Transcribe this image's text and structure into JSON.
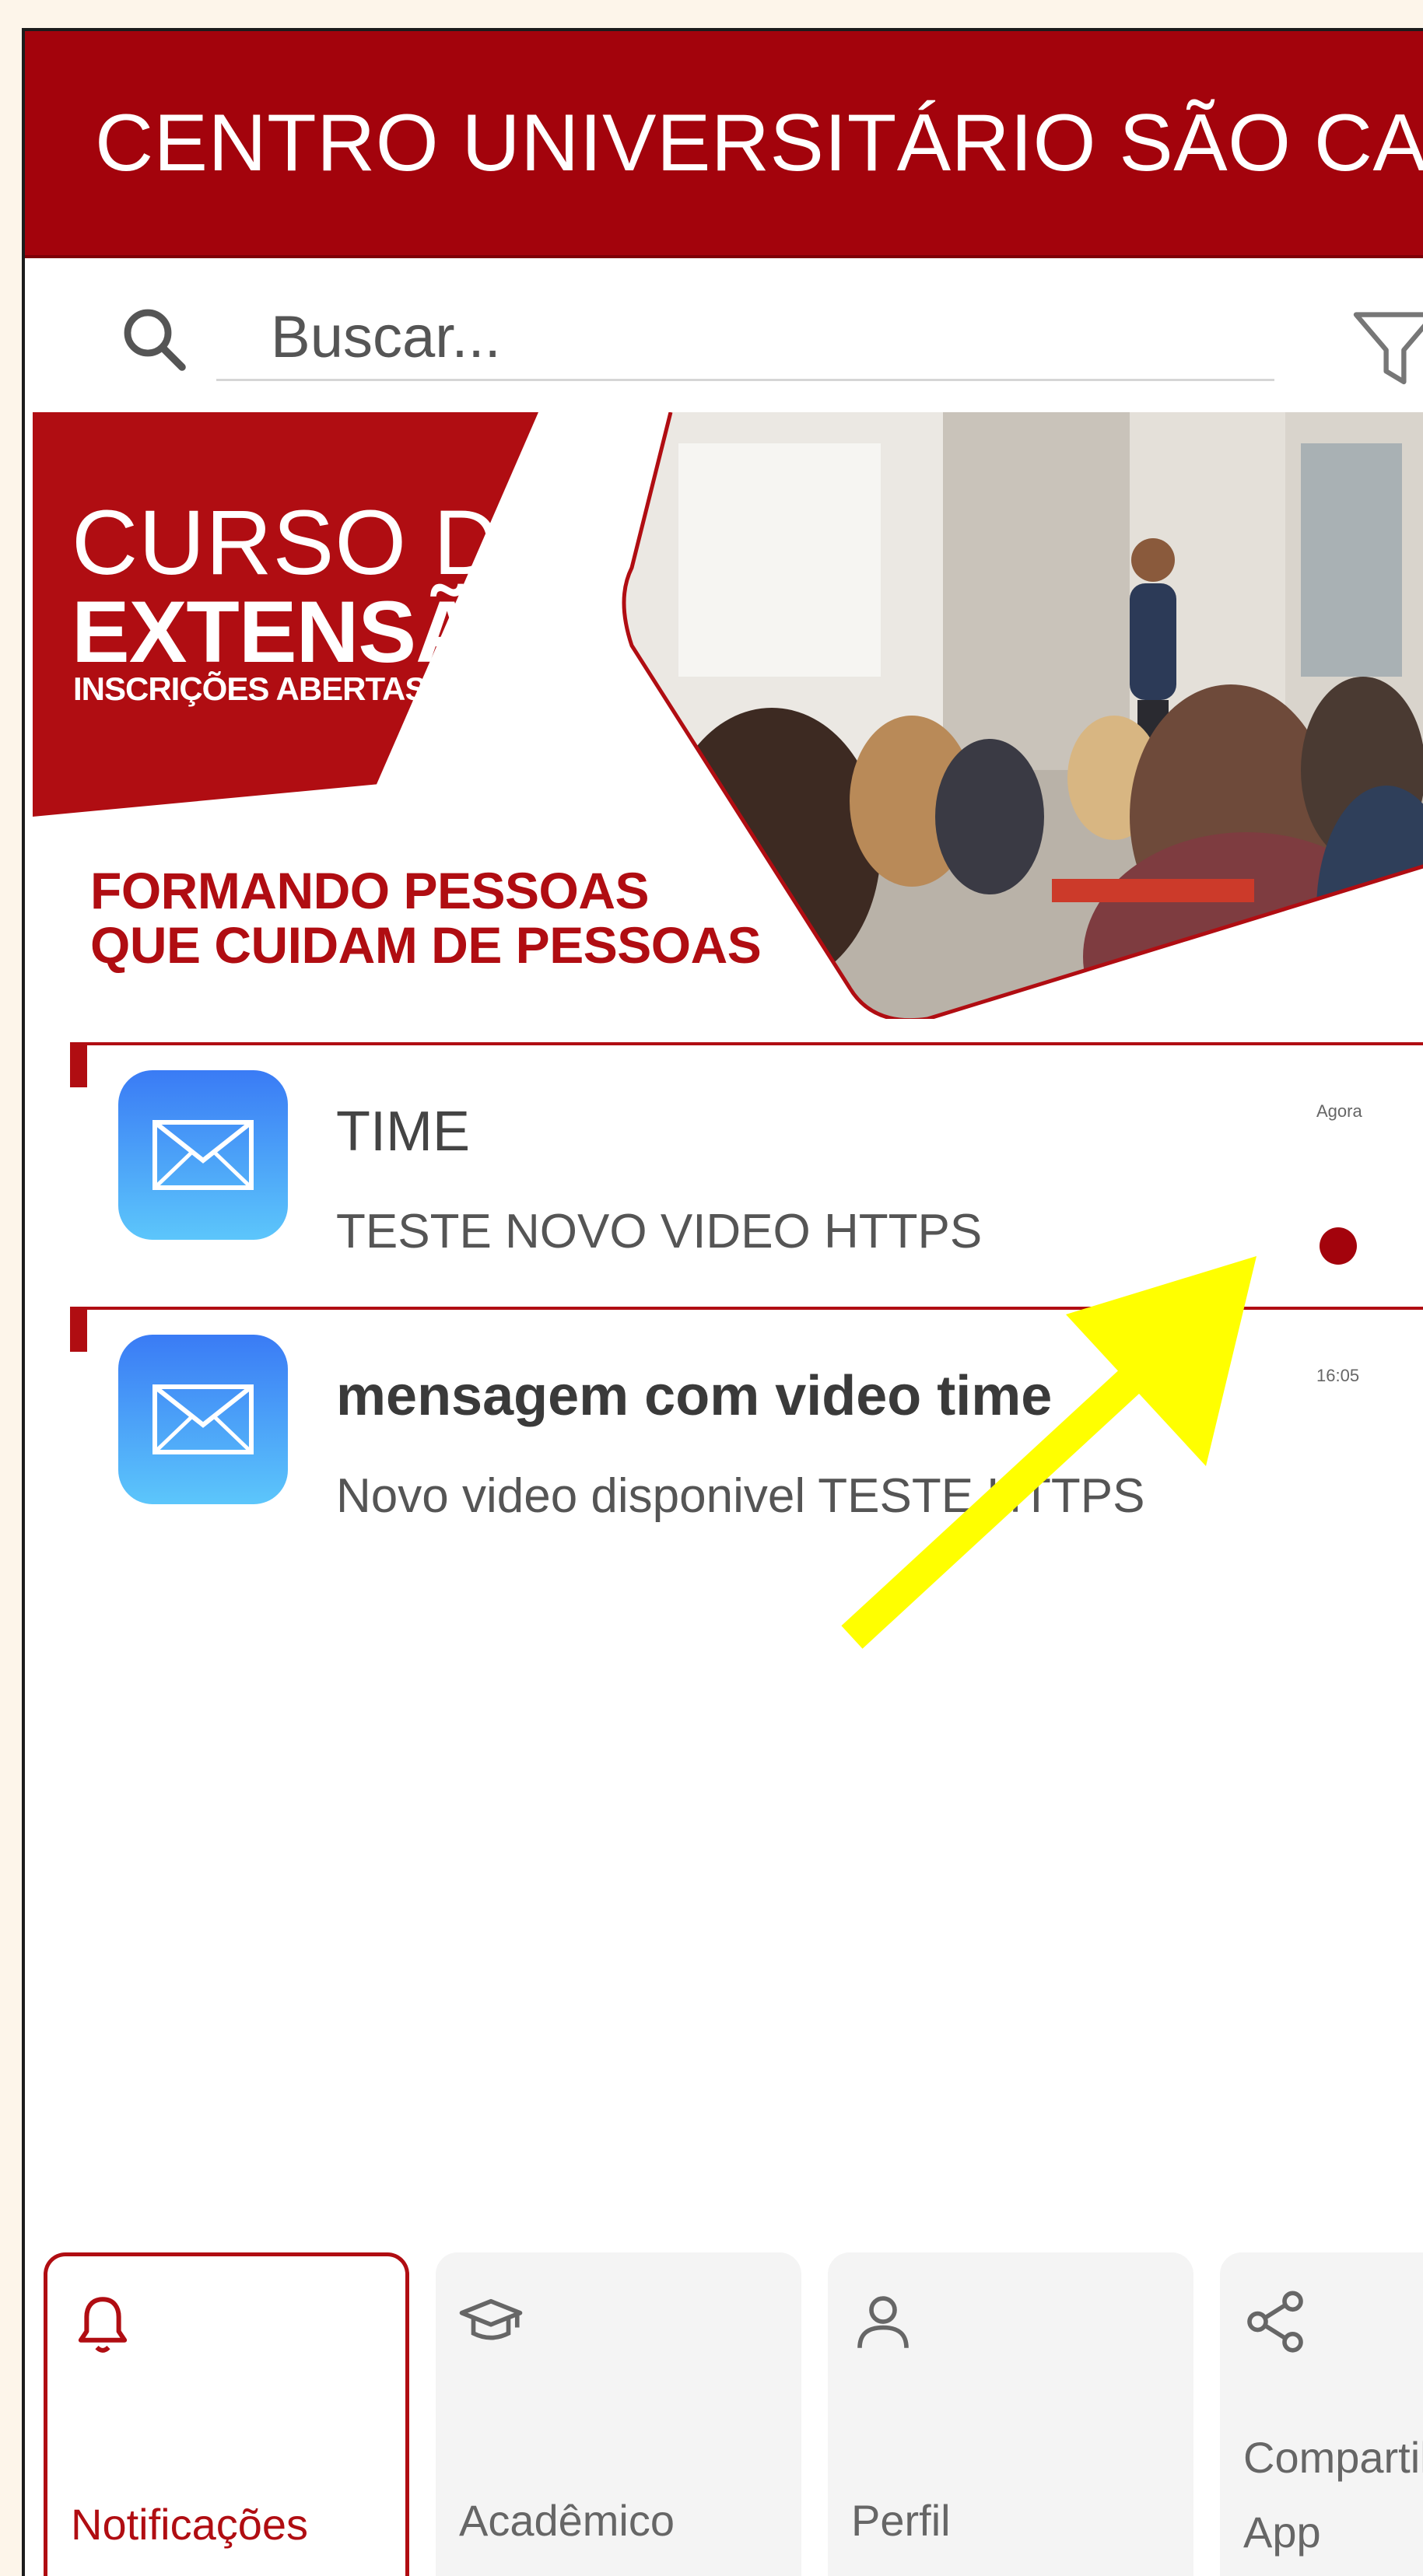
{
  "header": {
    "title": "CENTRO UNIVERSITÁRIO SÃO CA..."
  },
  "search": {
    "placeholder": "Buscar...",
    "icon": "search-icon",
    "filter_icon": "filter-icon"
  },
  "banner": {
    "line1": "CURSO DE",
    "line2": "EXTENSÃO",
    "line3": "INSCRIÇÕES ABERTAS",
    "slogan_line1": "FORMANDO PESSOAS",
    "slogan_line2": "QUE CUIDAM DE PESSOAS"
  },
  "notifications": [
    {
      "title": "TIME",
      "body": "TESTE NOVO VIDEO HTTPS",
      "time": "Agora",
      "unread": true,
      "icon": "mail-icon"
    },
    {
      "title": "mensagem com video time",
      "body": "Novo video disponivel TESTE HTTPS",
      "time": "16:05",
      "unread": false,
      "icon": "mail-icon"
    }
  ],
  "bottom_nav": [
    {
      "label": "Notificações",
      "icon": "bell-icon",
      "active": true
    },
    {
      "label": "Acadêmico",
      "icon": "graduation-cap-icon",
      "active": false
    },
    {
      "label": "Perfil",
      "icon": "user-icon",
      "active": false
    },
    {
      "label": "Compartilhar App",
      "icon": "share-icon",
      "active": false
    }
  ],
  "colors": {
    "brand_red": "#a3030c",
    "accent_red": "#b00d12",
    "annotation_arrow": "#ffff00",
    "mail_icon_gradient_top": "#3a7bf5",
    "mail_icon_gradient_bottom": "#5cc6fb"
  }
}
